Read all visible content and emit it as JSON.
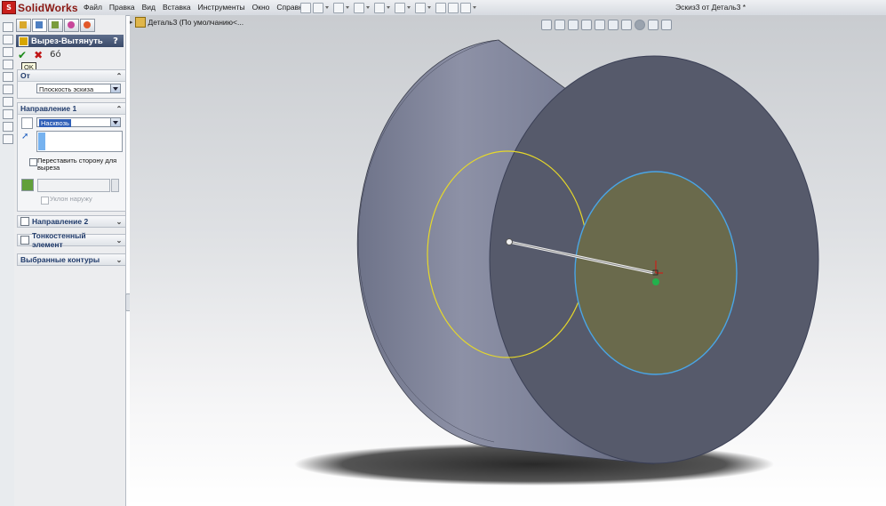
{
  "app": {
    "name": "SolidWorks",
    "document_title": "Эскиз3 от Деталь3 *"
  },
  "menu": [
    "Файл",
    "Правка",
    "Вид",
    "Вставка",
    "Инструменты",
    "Окно",
    "Справка"
  ],
  "feature_tree_flyout": {
    "label": "Деталь3  (По умолчанию<..."
  },
  "property_manager": {
    "title": "Вырез-Вытянуть",
    "help": "?",
    "ok_tooltip": "OK",
    "from_group": {
      "title": "От",
      "value": "Плоскость эскиза"
    },
    "direction1": {
      "title": "Направление 1",
      "end_condition": "Насквозь",
      "flip_side_label": "Переставить сторону для выреза",
      "draft_outward_label": "Уклон наружу"
    },
    "direction2": {
      "title": "Направление 2"
    },
    "thin_feature": {
      "title": "Тонкостенный элемент"
    },
    "selected_contours": {
      "title": "Выбранные контуры"
    }
  },
  "colors": {
    "accent": "#3a4a69",
    "highlight": "#2f5fb8",
    "sketch_circle_blue": "#4aa5e6",
    "sketch_circle_yellow": "#e6d82a",
    "part_face": "#565a6b",
    "part_side": "#7b8097"
  },
  "icons": {
    "ok": "check-icon",
    "cancel": "x-icon",
    "detailed_preview": "glasses-icon",
    "flip": "reverse-direction-icon"
  }
}
